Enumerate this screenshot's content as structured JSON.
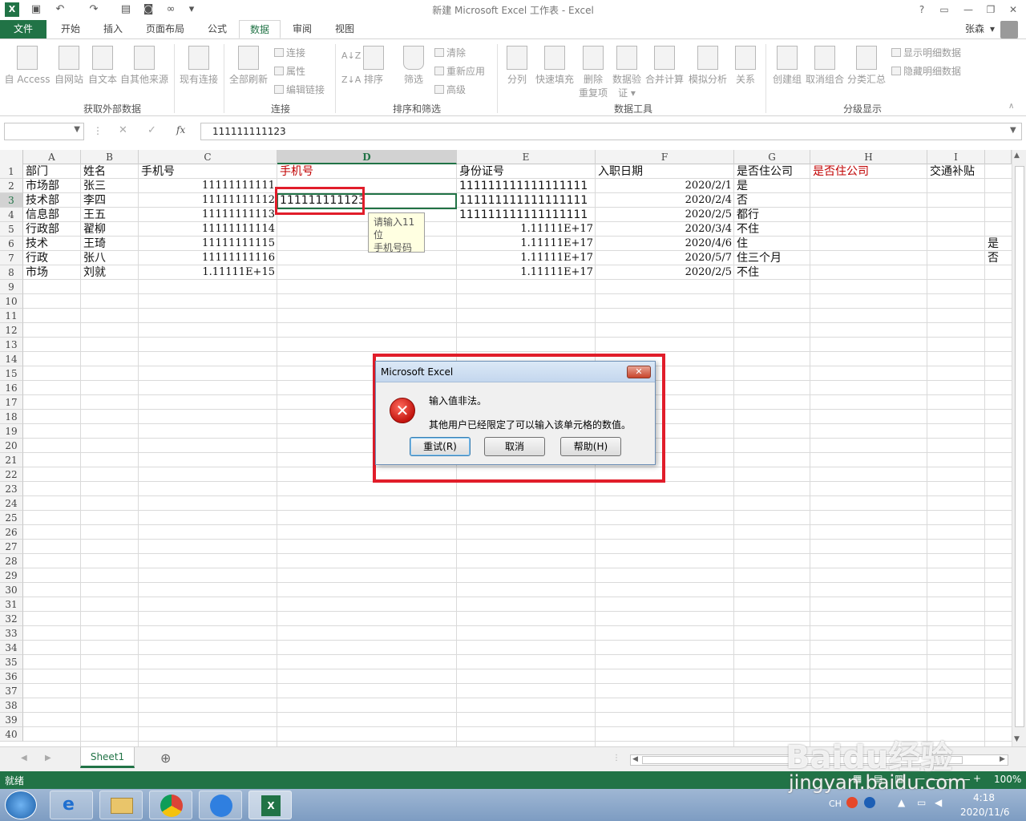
{
  "window": {
    "title": "新建 Microsoft Excel 工作表 - Excel",
    "help_glyph": "?",
    "user": "张森",
    "user_arrow": "▾"
  },
  "tabs": [
    {
      "label": "文件"
    },
    {
      "label": "开始"
    },
    {
      "label": "插入"
    },
    {
      "label": "页面布局"
    },
    {
      "label": "公式"
    },
    {
      "label": "数据"
    },
    {
      "label": "审阅"
    },
    {
      "label": "视图"
    }
  ],
  "ribbon": {
    "get_external": {
      "buttons": [
        "自 Access",
        "自网站",
        "自文本",
        "自其他来源"
      ],
      "existing": "现有连接",
      "label": "获取外部数据"
    },
    "connections": {
      "refresh_all": "全部刷新",
      "items": [
        "连接",
        "属性",
        "编辑链接"
      ],
      "label": "连接"
    },
    "sort_filter": {
      "sort": "排序",
      "filter": "筛选",
      "items": [
        "清除",
        "重新应用",
        "高级"
      ],
      "label": "排序和筛选"
    },
    "data_tools": {
      "buttons": [
        "分列",
        "快速填充",
        "删除",
        "数据验",
        "合并计算",
        "模拟分析",
        "关系"
      ],
      "second_lines": [
        "重复项",
        "证 ▾"
      ],
      "label": "数据工具"
    },
    "outline": {
      "buttons": [
        "创建组",
        "取消组合",
        "分类汇总"
      ],
      "items": [
        "显示明细数据",
        "隐藏明细数据"
      ],
      "label": "分级显示"
    }
  },
  "formula_bar": {
    "fx": "fx",
    "value": "111111111123"
  },
  "columns": [
    "A",
    "B",
    "C",
    "D",
    "E",
    "F",
    "G",
    "H",
    "I"
  ],
  "rows": [
    "1",
    "2",
    "3",
    "4",
    "5",
    "6",
    "7",
    "8",
    "9",
    "10",
    "11",
    "12",
    "13",
    "14",
    "15",
    "16",
    "17",
    "18",
    "19",
    "20",
    "21",
    "22",
    "23",
    "24",
    "25",
    "26",
    "27",
    "28",
    "29",
    "30",
    "31",
    "32",
    "33",
    "34",
    "35",
    "36",
    "37",
    "38",
    "39",
    "40"
  ],
  "cells": {
    "header": [
      "部门",
      "姓名",
      "手机号",
      "手机号",
      "身份证号",
      "入职日期",
      "是否住公司",
      "是否住公司",
      "交通补贴"
    ],
    "data": [
      [
        "市场部",
        "张三",
        "11111111111",
        "",
        "111111111111111111",
        "2020/2/1",
        "是",
        "",
        ""
      ],
      [
        "技术部",
        "李四",
        "11111111112",
        "111111111123",
        "111111111111111111",
        "2020/2/4",
        "否",
        "",
        ""
      ],
      [
        "信息部",
        "王五",
        "11111111113",
        "",
        "111111111111111111",
        "2020/2/5",
        "都行",
        "",
        ""
      ],
      [
        "行政部",
        "翟柳",
        "11111111114",
        "",
        "1.11111E+17",
        "2020/3/4",
        "不住",
        "",
        ""
      ],
      [
        "技术",
        "王琦",
        "11111111115",
        "",
        "1.11111E+17",
        "2020/4/6",
        "住",
        "",
        ""
      ],
      [
        "行政",
        "张八",
        "11111111116",
        "",
        "1.11111E+17",
        "2020/5/7",
        "住三个月",
        "",
        ""
      ],
      [
        "市场",
        "刘就",
        "1.11111E+15",
        "",
        "1.11111E+17",
        "2020/2/5",
        "不住",
        "",
        ""
      ]
    ],
    "overflow_right": [
      "是",
      "否"
    ]
  },
  "tooltip": {
    "line1": "请输入11位",
    "line2": "手机号码"
  },
  "dialog": {
    "title": "Microsoft Excel",
    "close": "✕",
    "message1": "输入值非法。",
    "message2": "其他用户已经限定了可以输入该单元格的数值。",
    "buttons": [
      "重试(R)",
      "取消",
      "帮助(H)"
    ]
  },
  "sheet_tabs": {
    "active": "Sheet1",
    "add": "⊕"
  },
  "status": {
    "mode": "就绪",
    "zoom": "100%"
  },
  "taskbar": {
    "lang": "CH",
    "time": "4:18",
    "date": "2020/11/6"
  },
  "watermark": {
    "text1": "Baidu经验",
    "text2": "jingyan.baidu.com"
  },
  "colors": {
    "excel_green": "#217346",
    "highlight_red": "#e11d2a",
    "header_red": "#c00000"
  }
}
